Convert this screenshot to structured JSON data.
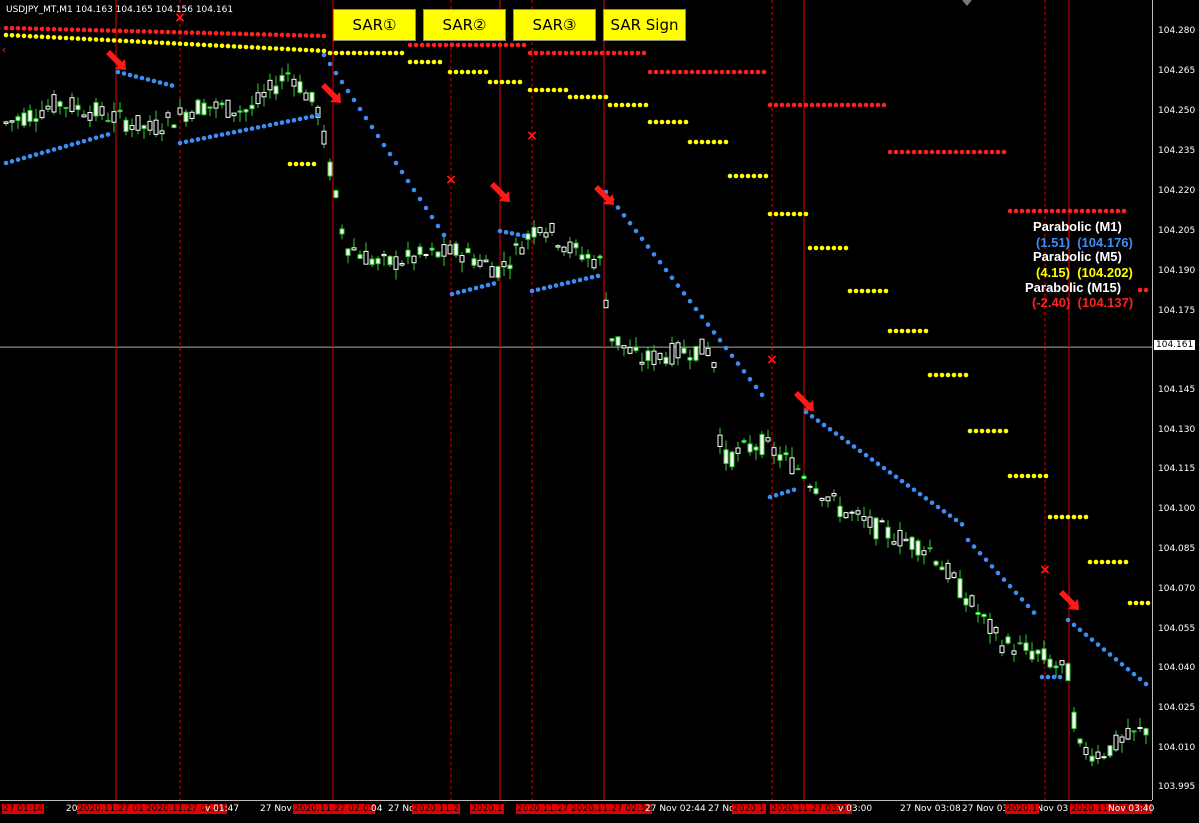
{
  "title": "USDJPY_MT,M1  104.163 104.165 104.156 104.161",
  "buttons": [
    {
      "label": "SAR①"
    },
    {
      "label": "SAR②"
    },
    {
      "label": "SAR③"
    },
    {
      "label": "SAR Sign"
    }
  ],
  "indicators": {
    "m1": {
      "name": "Parabolic (M1)",
      "value1": "(1.51)",
      "value2": "(104.176)",
      "color": "#3b8ef5"
    },
    "m5": {
      "name": "Parabolic (M5)",
      "value1": "(4.15)",
      "value2": "(104.202)",
      "color": "#ffff00"
    },
    "m15": {
      "name": "Parabolic (M15)",
      "value1": "(-2.40)",
      "value2": "(104.137)",
      "color": "#ff2020"
    }
  },
  "price_axis": {
    "labels": [
      "104.280",
      "104.265",
      "104.250",
      "104.235",
      "104.220",
      "104.205",
      "104.190",
      "104.175",
      "104.161",
      "104.145",
      "104.130",
      "104.115",
      "104.100",
      "104.085",
      "104.070",
      "104.055",
      "104.040",
      "104.025",
      "104.010",
      "103.995"
    ],
    "current": "104.161"
  },
  "time_axis": {
    "labels": [
      {
        "text": "27 01:14",
        "red": true
      },
      {
        "text": "20",
        "red": false
      },
      {
        "text": "27",
        "red": false
      },
      {
        "text": "2020.11.27 01",
        "red": true
      },
      {
        "text": "2020.11.27 01:45",
        "red": true
      },
      {
        "text": "v 01:47",
        "red": false
      },
      {
        "text": "27 Nov",
        "red": false
      },
      {
        "text": "2020.11.27 02:05",
        "red": true
      },
      {
        "text": "04",
        "red": false
      },
      {
        "text": "27 No",
        "red": false
      },
      {
        "text": "2020.11.2",
        "red": true
      },
      {
        "text": "2020.1",
        "red": true
      },
      {
        "text": "2020.11.27 02:3",
        "red": true
      },
      {
        "text": "2020.11.27 02:39",
        "red": true
      },
      {
        "text": "27 Nov 02:44",
        "red": false
      },
      {
        "text": "27 No",
        "red": false
      },
      {
        "text": "2020.1",
        "red": true
      },
      {
        "text": "2020.11.27 03:04",
        "red": true
      },
      {
        "text": "v 03:00",
        "red": false
      },
      {
        "text": "27 Nov 03:08",
        "red": false
      },
      {
        "text": "27 Nov 03:16",
        "red": false
      },
      {
        "text": "27 Nov 03",
        "red": false
      },
      {
        "text": "2020.1",
        "red": true
      },
      {
        "text": "2020.11.27 03:37",
        "red": true
      },
      {
        "text": "Nov 03:40",
        "red": false
      }
    ]
  },
  "colors": {
    "bull": "#ffffff",
    "bear": "#33cc33",
    "m1": "#3b8ef5",
    "m5": "#ffff00",
    "m15": "#ff2020",
    "vline": "#e00000"
  }
}
